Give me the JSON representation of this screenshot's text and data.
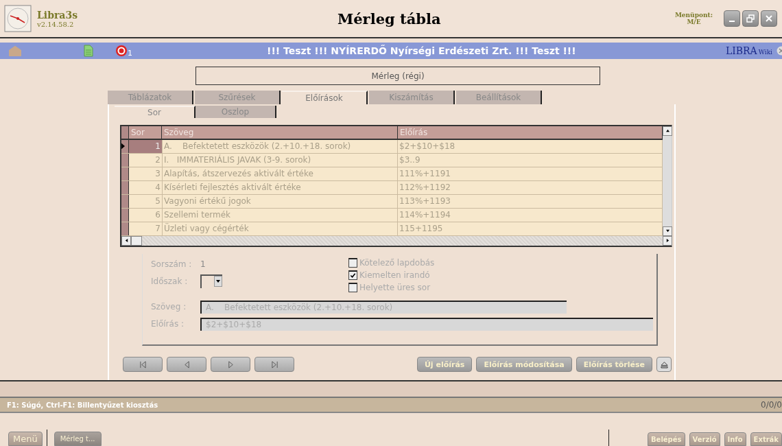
{
  "app": {
    "name": "Libra3s",
    "version": "v2.14.58.2"
  },
  "window": {
    "title": "Mérleg tábla",
    "menu_label": "Menüpont:",
    "menu_code": "M/E"
  },
  "banner": {
    "alert_count": "1",
    "text": "!!! Teszt !!! NYÍRERDŐ Nyírségi Erdészeti Zrt. !!! Teszt !!!",
    "wiki_brand": "LIBRA",
    "wiki_label": "Wiki"
  },
  "form_title": "Mérleg (régi)",
  "tabs": [
    {
      "label": "Táblázatok",
      "selected": false
    },
    {
      "label": "Szűrések",
      "selected": false
    },
    {
      "label": "Előírások",
      "selected": true
    },
    {
      "label": "Kiszámítás",
      "selected": false
    },
    {
      "label": "Beállítások",
      "selected": false
    }
  ],
  "subtabs": [
    {
      "label": "Sor",
      "selected": true
    },
    {
      "label": "Oszlop",
      "selected": false
    }
  ],
  "table": {
    "columns": [
      "Sor",
      "Szöveg",
      "Előírás"
    ],
    "rows": [
      {
        "num": "1",
        "text": "A.    Befektetett eszközök (2.+10.+18. sorok)",
        "formula": "$2+$10+$18",
        "selected": true
      },
      {
        "num": "2",
        "text": "I.   IMMATERIÁLIS JAVAK (3-9. sorok)",
        "formula": "$3..9",
        "selected": false
      },
      {
        "num": "3",
        "text": "Alapítás, átszervezés aktivált értéke",
        "formula": "111%+1191",
        "selected": false
      },
      {
        "num": "4",
        "text": "Kísérleti fejlesztés aktivált értéke",
        "formula": "112%+1192",
        "selected": false
      },
      {
        "num": "5",
        "text": "Vagyoni értékű jogok",
        "formula": "113%+1193",
        "selected": false
      },
      {
        "num": "6",
        "text": "Szellemi termék",
        "formula": "114%+1194",
        "selected": false
      },
      {
        "num": "7",
        "text": "Üzleti vagy cégérték",
        "formula": "115+1195",
        "selected": false
      }
    ]
  },
  "detail": {
    "sorszam_label": "Sorszám :",
    "sorszam": "1",
    "idoszak_label": "Időszak :",
    "szoveg_label": "Szöveg :",
    "szoveg": "A.    Befektetett eszközök (2.+10.+18. sorok)",
    "eloiras_label": "Előírás :",
    "eloiras": "$2+$10+$18"
  },
  "checkboxes": [
    {
      "label": "Kötelező lapdobás",
      "checked": false
    },
    {
      "label": "Kiemelten irandó",
      "checked": true
    },
    {
      "label": "Helyette üres sor",
      "checked": false
    }
  ],
  "action_buttons": [
    "Új előírás",
    "Előírás módosítása",
    "Előírás törlése"
  ],
  "help_text": "F1: Súgó, Ctrl-F1: Billentyűzet kiosztás",
  "counter": "0/0/0",
  "taskbar": {
    "menu": "Menü",
    "window": "Mérleg t...",
    "buttons": [
      "Belépés",
      "Verzió",
      "Info",
      "Extrák"
    ]
  }
}
